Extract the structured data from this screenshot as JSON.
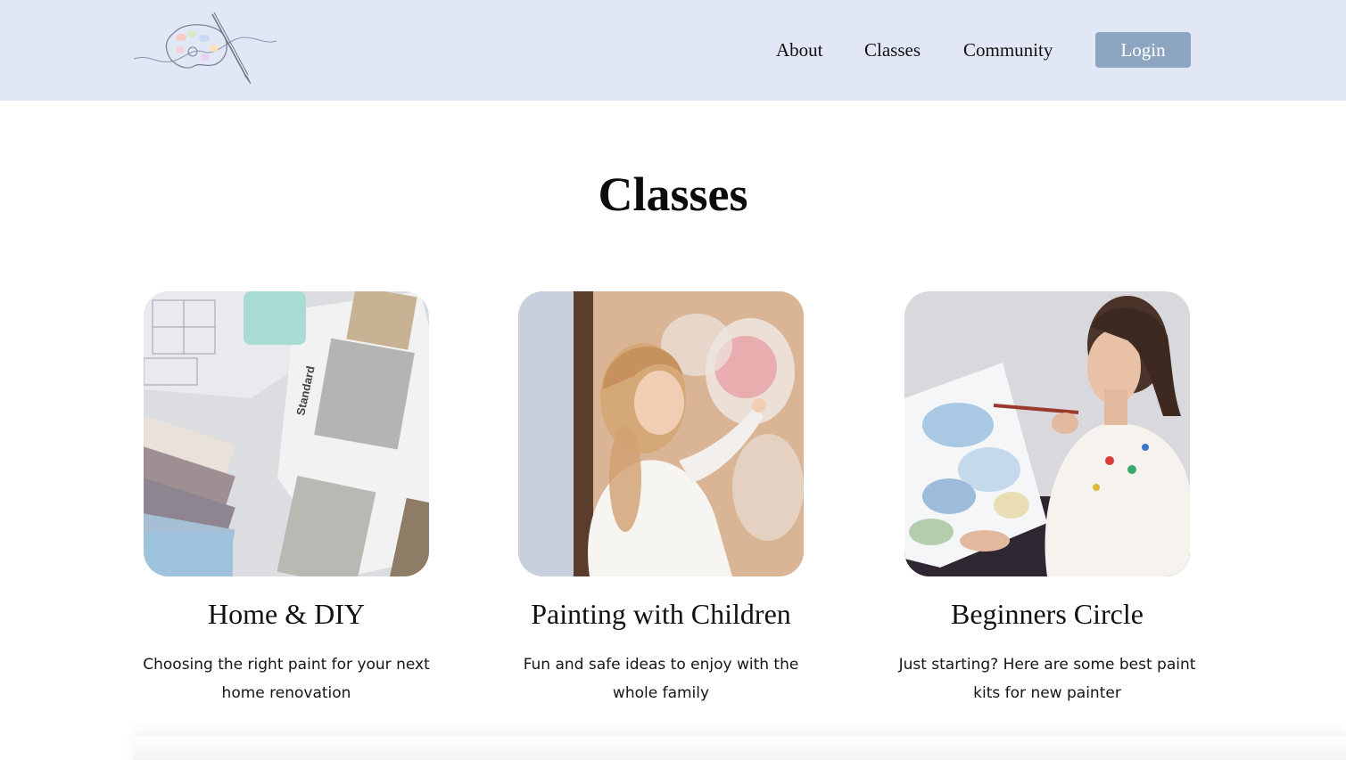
{
  "header": {
    "logo_icon": "palette-brush-logo",
    "nav": [
      {
        "label": "About"
      },
      {
        "label": "Classes"
      },
      {
        "label": "Community"
      }
    ],
    "login_label": "Login"
  },
  "main": {
    "title": "Classes",
    "cards": [
      {
        "title": "Home & DIY",
        "description": "Choosing the right paint for your next home renovation",
        "image_icon": "paint-swatches-photo"
      },
      {
        "title": "Painting with Children",
        "description": "Fun and safe ideas to enjoy with the whole family",
        "image_icon": "child-painting-photo"
      },
      {
        "title": "Beginners Circle",
        "description": "Just starting? Here are some best paint kits for new painter",
        "image_icon": "woman-painting-photo"
      }
    ]
  },
  "colors": {
    "header_bg": "#e1e7f4",
    "login_bg": "#8ea5c1",
    "title_highlight": "#ecdffa"
  }
}
